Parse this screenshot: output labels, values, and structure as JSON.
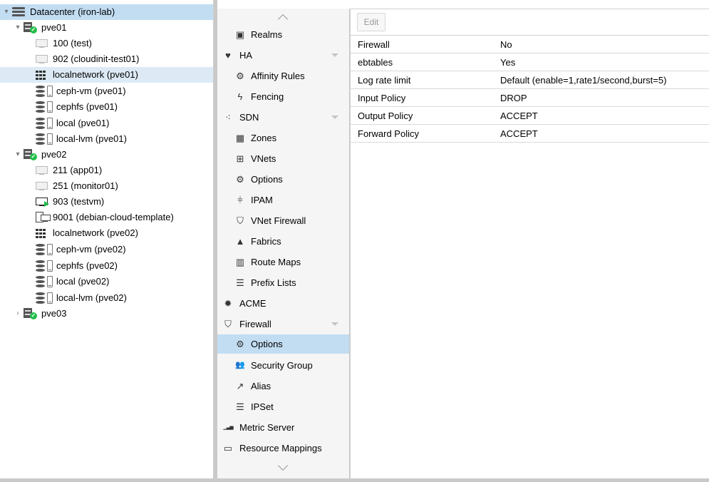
{
  "tree": {
    "datacenter": "Datacenter (iron-lab)",
    "nodes": [
      {
        "name": "pve01",
        "children": [
          {
            "label": "100 (test)",
            "type": "vm"
          },
          {
            "label": "902 (cloudinit-test01)",
            "type": "vm"
          },
          {
            "label": "localnetwork (pve01)",
            "type": "network"
          },
          {
            "label": "ceph-vm (pve01)",
            "type": "storage"
          },
          {
            "label": "cephfs (pve01)",
            "type": "storage"
          },
          {
            "label": "local (pve01)",
            "type": "storage"
          },
          {
            "label": "local-lvm (pve01)",
            "type": "storage"
          }
        ]
      },
      {
        "name": "pve02",
        "children": [
          {
            "label": "211 (app01)",
            "type": "vm"
          },
          {
            "label": "251 (monitor01)",
            "type": "vm"
          },
          {
            "label": "903 (testvm)",
            "type": "vm-running"
          },
          {
            "label": "9001 (debian-cloud-template)",
            "type": "template"
          },
          {
            "label": "localnetwork (pve02)",
            "type": "network"
          },
          {
            "label": "ceph-vm (pve02)",
            "type": "storage"
          },
          {
            "label": "cephfs (pve02)",
            "type": "storage"
          },
          {
            "label": "local (pve02)",
            "type": "storage"
          },
          {
            "label": "local-lvm (pve02)",
            "type": "storage"
          }
        ]
      },
      {
        "name": "pve03",
        "children": []
      }
    ]
  },
  "menu": {
    "items": [
      {
        "label": "Realms",
        "icon": "address-book-icon",
        "glyph": "▣",
        "level": 2
      },
      {
        "label": "HA",
        "icon": "heartbeat-icon",
        "glyph": "♥",
        "level": 1,
        "expandable": true
      },
      {
        "label": "Affinity Rules",
        "icon": "cogs-icon",
        "glyph": "⚙",
        "level": 2
      },
      {
        "label": "Fencing",
        "icon": "bolt-icon",
        "glyph": "ϟ",
        "level": 2
      },
      {
        "label": "SDN",
        "icon": "sdn-icon",
        "glyph": "⁖",
        "level": 1,
        "expandable": true
      },
      {
        "label": "Zones",
        "icon": "th-icon",
        "glyph": "▦",
        "level": 2
      },
      {
        "label": "VNets",
        "icon": "sitemap-icon",
        "glyph": "⊞",
        "level": 2
      },
      {
        "label": "Options",
        "icon": "gear-icon",
        "glyph": "⚙",
        "level": 2
      },
      {
        "label": "IPAM",
        "icon": "ipam-icon",
        "glyph": "⫩",
        "level": 2
      },
      {
        "label": "VNet Firewall",
        "icon": "shield-icon",
        "glyph": "⛉",
        "level": 2
      },
      {
        "label": "Fabrics",
        "icon": "road-icon",
        "glyph": "▲",
        "level": 2
      },
      {
        "label": "Route Maps",
        "icon": "map-icon",
        "glyph": "▥",
        "level": 2
      },
      {
        "label": "Prefix Lists",
        "icon": "list-icon",
        "glyph": "☰",
        "level": 2
      },
      {
        "label": "ACME",
        "icon": "certificate-icon",
        "glyph": "✹",
        "level": 1
      },
      {
        "label": "Firewall",
        "icon": "shield-icon",
        "glyph": "⛉",
        "level": 1,
        "expandable": true
      },
      {
        "label": "Options",
        "icon": "gear-icon",
        "glyph": "⚙",
        "level": 2,
        "selected": true
      },
      {
        "label": "Security Group",
        "icon": "group-icon",
        "glyph": "👥",
        "level": 2
      },
      {
        "label": "Alias",
        "icon": "external-link-icon",
        "glyph": "↗",
        "level": 2
      },
      {
        "label": "IPSet",
        "icon": "list-icon",
        "glyph": "☰",
        "level": 2
      },
      {
        "label": "Metric Server",
        "icon": "bar-chart-icon",
        "glyph": "▁▃▅",
        "level": 1
      },
      {
        "label": "Resource Mappings",
        "icon": "folder-icon",
        "glyph": "▭",
        "level": 1
      }
    ]
  },
  "toolbar": {
    "edit_label": "Edit"
  },
  "options": {
    "rows": [
      {
        "key": "Firewall",
        "value": "No"
      },
      {
        "key": "ebtables",
        "value": "Yes"
      },
      {
        "key": "Log rate limit",
        "value": "Default (enable=1,rate1/second,burst=5)"
      },
      {
        "key": "Input Policy",
        "value": "DROP"
      },
      {
        "key": "Output Policy",
        "value": "ACCEPT"
      },
      {
        "key": "Forward Policy",
        "value": "ACCEPT"
      }
    ]
  }
}
